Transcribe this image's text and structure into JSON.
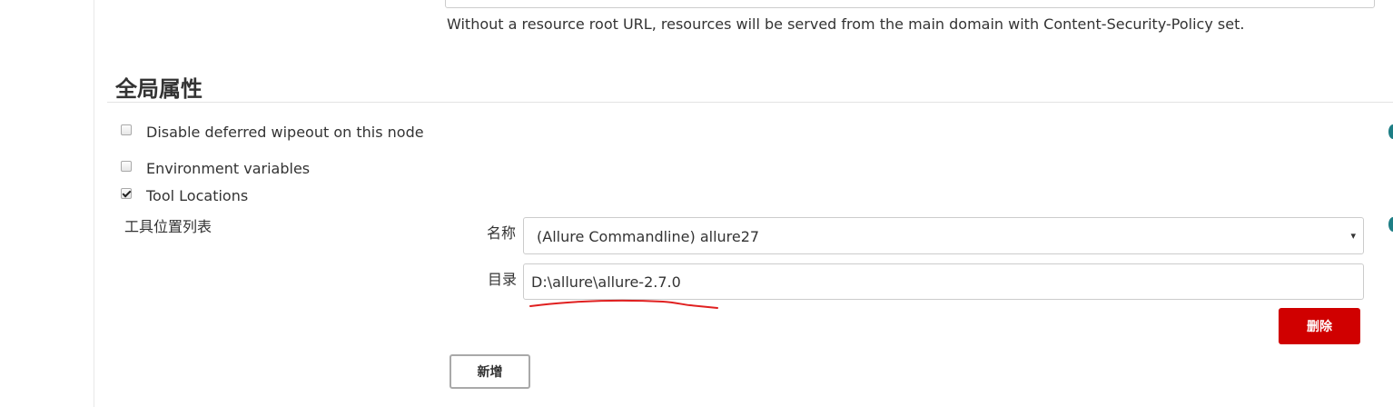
{
  "resource_root": {
    "help_text": "Without a resource root URL, resources will be served from the main domain with Content-Security-Policy set."
  },
  "section": {
    "title": "全局属性"
  },
  "properties": [
    {
      "label": "Disable deferred wipeout on this node",
      "checked": false
    },
    {
      "label": "Environment variables",
      "checked": false
    },
    {
      "label": "Tool Locations",
      "checked": true
    }
  ],
  "tool_locations": {
    "list_label": "工具位置列表",
    "name_label": "名称",
    "name_value": "(Allure Commandline) allure27",
    "dir_label": "目录",
    "dir_value": "D:\\allure\\allure-2.7.0",
    "delete_label": "删除",
    "add_label": "新增"
  },
  "colors": {
    "delete_button": "#d00000",
    "help_icon": "#1d7e85",
    "annotation": "#e02020"
  },
  "icons": {
    "select_arrow": "▾"
  }
}
